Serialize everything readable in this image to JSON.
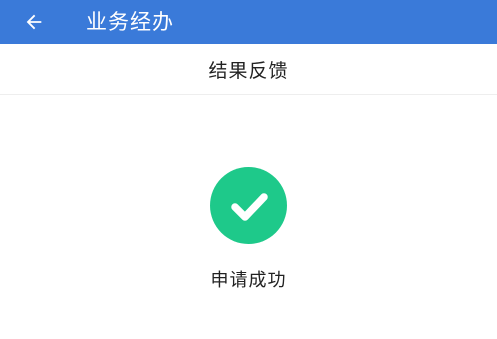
{
  "app_bar": {
    "title": "业务经办",
    "back_icon": "back-arrow-icon",
    "background_color": "#3a7ad9"
  },
  "subheader": {
    "title": "结果反馈"
  },
  "result": {
    "icon": "check-circle-icon",
    "icon_color": "#1ec98a",
    "message": "申请成功"
  }
}
